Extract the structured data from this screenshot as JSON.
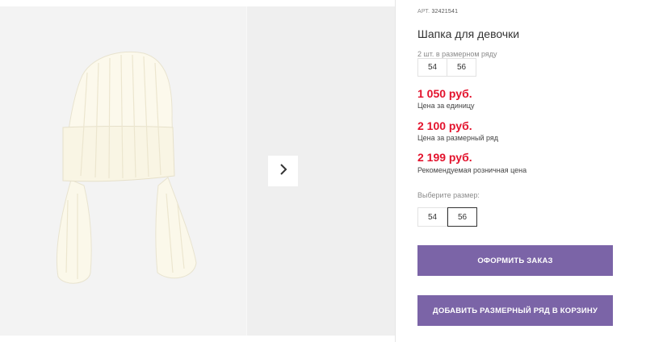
{
  "product": {
    "article_label": "АРТ.",
    "article_number": "32421541",
    "title": "Шапка для девочки"
  },
  "size_range": {
    "count_text": "2 шт. в размерном ряду",
    "sizes": [
      "54",
      "56"
    ]
  },
  "prices": [
    {
      "value": "1 050 руб.",
      "label": "Цена за единицу"
    },
    {
      "value": "2 100 руб.",
      "label": "Цена за размерный ряд"
    },
    {
      "value": "2 199 руб.",
      "label": "Рекомендуемая розничная цена"
    }
  ],
  "size_picker": {
    "label": "Выберите размер:",
    "options": [
      "54",
      "56"
    ],
    "selected": "56"
  },
  "buttons": {
    "checkout": "ОФОРМИТЬ ЗАКАЗ",
    "add_range": "ДОБАВИТЬ РАЗМЕРНЫЙ РЯД В КОРЗИНУ"
  },
  "colors": {
    "price": "#e3132d",
    "button": "#7b64a7",
    "hat": "#fbf8ea"
  },
  "icons": {
    "gallery_next": "chevron-right-icon"
  }
}
